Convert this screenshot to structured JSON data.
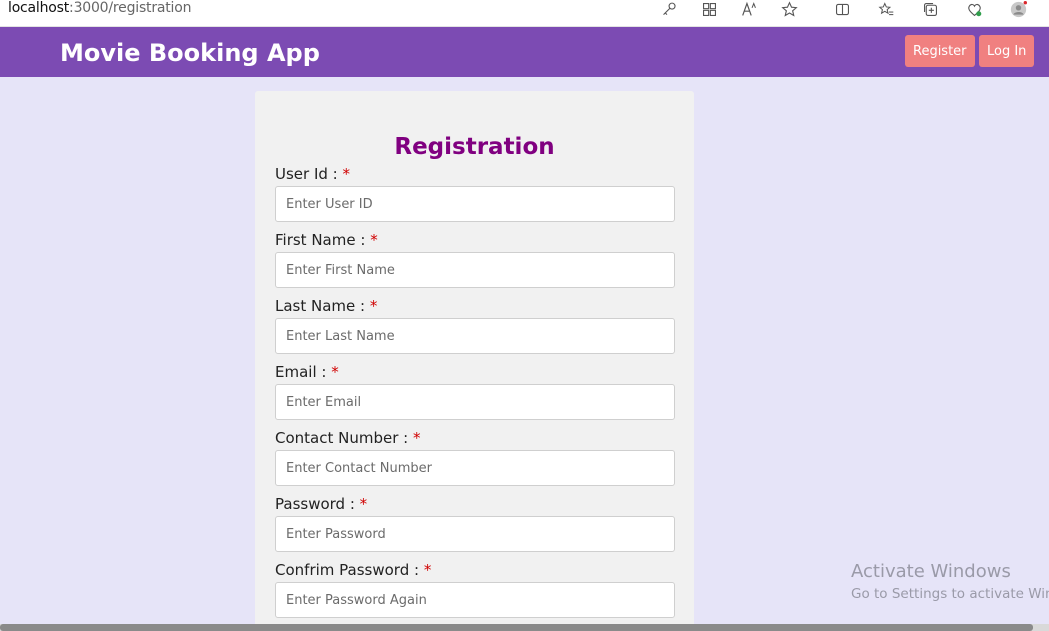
{
  "browser": {
    "url_host": "localhost",
    "url_path": ":3000/registration",
    "toolbar_icons": [
      "key-icon",
      "apps-icon",
      "read-aloud-icon",
      "favorite-star-icon",
      "split-screen-icon",
      "favorites-icon",
      "collections-icon",
      "performance-icon",
      "profile-avatar"
    ]
  },
  "navbar": {
    "brand": "Movie Booking App",
    "register_label": "Register",
    "login_label": "Log In",
    "bg_color": "#7c4bb3",
    "button_color": "#f08080"
  },
  "form": {
    "title": "Registration",
    "title_color": "#800080",
    "fields": [
      {
        "label": "User Id :",
        "required": "*",
        "placeholder": "Enter User ID"
      },
      {
        "label": "First Name :",
        "required": "*",
        "placeholder": "Enter First Name"
      },
      {
        "label": "Last Name :",
        "required": "*",
        "placeholder": "Enter Last Name"
      },
      {
        "label": "Email :",
        "required": "*",
        "placeholder": "Enter Email"
      },
      {
        "label": "Contact Number :",
        "required": "*",
        "placeholder": "Enter Contact Number"
      },
      {
        "label": "Password :",
        "required": "*",
        "placeholder": "Enter Password"
      },
      {
        "label": "Confrim Password :",
        "required": "*",
        "placeholder": "Enter Password Again"
      }
    ]
  },
  "watermark": {
    "line1": "Activate Windows",
    "line2": "Go to Settings to activate Windows."
  }
}
